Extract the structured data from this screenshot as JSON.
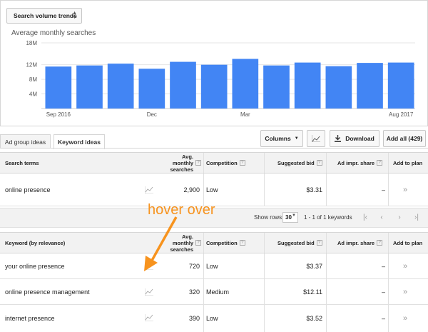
{
  "trend_dropdown": {
    "label": "Search volume trends"
  },
  "chart_data": {
    "type": "bar",
    "title": "Average monthly searches",
    "y_ticks": [
      "18M",
      "12M",
      "8M",
      "4M"
    ],
    "ylim": [
      0,
      18
    ],
    "x_tick_labels": [
      "Sep 2016",
      "Dec",
      "Mar",
      "Aug 2017"
    ],
    "categories": [
      "Sep 2016",
      "Oct 2016",
      "Nov 2016",
      "Dec 2016",
      "Jan 2017",
      "Feb 2017",
      "Mar 2017",
      "Apr 2017",
      "May 2017",
      "Jun 2017",
      "Jul 2017",
      "Aug 2017"
    ],
    "values": [
      11.5,
      11.8,
      12.3,
      10.9,
      12.8,
      12.0,
      13.6,
      11.8,
      12.6,
      11.6,
      12.5,
      12.6
    ],
    "bar_color": "#4285f4",
    "grid": true
  },
  "tabs": [
    {
      "label": "Ad group ideas"
    },
    {
      "label": "Keyword ideas"
    }
  ],
  "toolbar": {
    "columns_label": "Columns",
    "download_label": "Download",
    "add_all_label": "Add all (429)"
  },
  "search_table": {
    "headers": {
      "term": "Search terms",
      "avg1": "Avg. monthly",
      "avg2": "searches",
      "competition": "Competition",
      "bid": "Suggested bid",
      "share": "Ad impr. share",
      "add": "Add to plan"
    },
    "rows": [
      {
        "keyword": "online presence",
        "searches": "2,900",
        "competition": "Low",
        "bid": "$3.31",
        "share": "–",
        "add": "»"
      }
    ]
  },
  "pager": {
    "rows_label": "Show rows:",
    "rows_value": "30",
    "range": "1 - 1 of 1 keywords"
  },
  "keyword_table": {
    "headers": {
      "term": "Keyword (by relevance)",
      "avg1": "Avg. monthly",
      "avg2": "searches",
      "competition": "Competition",
      "bid": "Suggested bid",
      "share": "Ad impr. share",
      "add": "Add to plan"
    },
    "rows": [
      {
        "keyword": "your online presence",
        "searches": "720",
        "competition": "Low",
        "bid": "$3.37",
        "share": "–",
        "add": "»"
      },
      {
        "keyword": "online presence management",
        "searches": "320",
        "competition": "Medium",
        "bid": "$12.11",
        "share": "–",
        "add": "»"
      },
      {
        "keyword": "internet presence",
        "searches": "390",
        "competition": "Low",
        "bid": "$3.52",
        "share": "–",
        "add": "»"
      }
    ]
  },
  "annotation": {
    "text": "hover over",
    "color": "#f7931e"
  }
}
